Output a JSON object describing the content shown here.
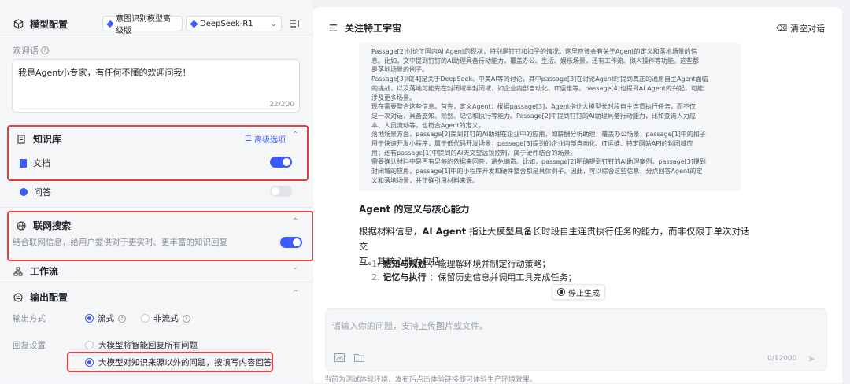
{
  "left": {
    "header": {
      "title": "模型配置",
      "model_tag_1": "意图识别模型高级版",
      "model_tag_2": "DeepSeek-R1"
    },
    "welcome": {
      "label": "欢迎语",
      "value": "我是Agent小专家，有任何不懂的欢迎问我！",
      "counter": "22/200"
    },
    "knowledge": {
      "title": "知识库",
      "advanced": "高级选项",
      "doc_label": "文档",
      "doc_on": true,
      "qa_label": "问答",
      "qa_on": false
    },
    "web_search": {
      "title": "联网搜索",
      "desc": "结合联网信息，给用户提供对于更实时、更丰富的知识回复",
      "on": true
    },
    "workflow": {
      "title": "工作流"
    },
    "output": {
      "title": "输出配置",
      "mode_label": "输出方式",
      "mode_stream": "流式",
      "mode_non_stream": "非流式",
      "reply_label": "回复设置",
      "reply_opt_1": "大模型将智能回复所有问题",
      "reply_opt_2": "大模型对知识来源以外的问题，按填写内容回答"
    }
  },
  "right": {
    "header": {
      "title": "关注特工宇宙",
      "clear": "清空对话"
    },
    "passage_lines": [
      "Passage[2]讨论了国内AI Agent的现状，特别是钉钉和扣子的情况。这里应该会有关于Agent的定义和落地场景的信",
      "息。比如，文中提到钉钉的AI助理具备行动能力，覆盖办公、生活、娱乐场景，还有工作流、拟人操作等功能。这些都",
      "是落地场景的例子。",
      "Passage[3]和[4]是关于DeepSeek、中美AI等的讨论，其中passage[3]在讨论Agent时提到真正的通用自主Agent面临",
      "的挑战，以及落地可能先在封闭域半封闭域，如企业内部自动化、IT运维等。passage[4]也提到AI Agent的兴起，可能",
      "涉及更多场景。",
      "现在需要整合这些信息。首先，定义Agent：根据passage[3]，Agent指让大模型长时段自主连贯执行任务，而不仅",
      "是一次对话，具备感知、规划、记忆和执行等能力。Passage[2]中提到钉钉的AI助理具备行动能力，比如查询人力成",
      "本、人员流动等，也符合Agent的定义。",
      "落地场景方面，passage[2]提到钉钉的AI助理在企业中的应用，如薪酬分析助理，覆盖办公场景；passage[1]中的扣子",
      "用于快速开发小程序，属于低代码开发场景；passage[3]提到的企业内部自动化、IT运维、特定网站API的封闭域应",
      "用；还有passage[1]中提到的AI天文望远镜控制，属于硬件结合的场景。",
      "需要确认材料中是否有足够的依据来回答，避免编造。比如，passage[2]明确提到钉钉的AI助理案例，passage[3]提到",
      "封闭域的应用，passage[1]中的小程序开发和硬件整合都是具体例子。因此，可以综合这些信息，分点回答Agent的定",
      "义和落地场景，并正确引用材料来源。"
    ],
    "answer": {
      "heading": "Agent 的定义与核心能力",
      "para_pre": "根据材料信息，",
      "para_bold": "AI Agent",
      "para_post_1": " 指让大模型具备长时段自主连贯执行任务的能力，而非仅限于单次对话交",
      "para_post_2": "互。其核心能力包括：",
      "item1_num": "1.",
      "item1_bold": "感知与规划",
      "item1_text": "：能理解环境并制定行动策略；",
      "item2_num": "2.",
      "item2_bold": "记忆与执行",
      "item2_text": "：保留历史信息并调用工具完成任务；"
    },
    "stop": "停止生成",
    "input": {
      "placeholder": "请输入你的问题，支持上传图片或文件。",
      "counter": "0/12000"
    },
    "footer": "当前为测试体验环境，发布后点击体验链接即可体验生产环境效果。"
  },
  "colors": {
    "accent": "#3b5bff",
    "highlight": "#e53d3d"
  }
}
